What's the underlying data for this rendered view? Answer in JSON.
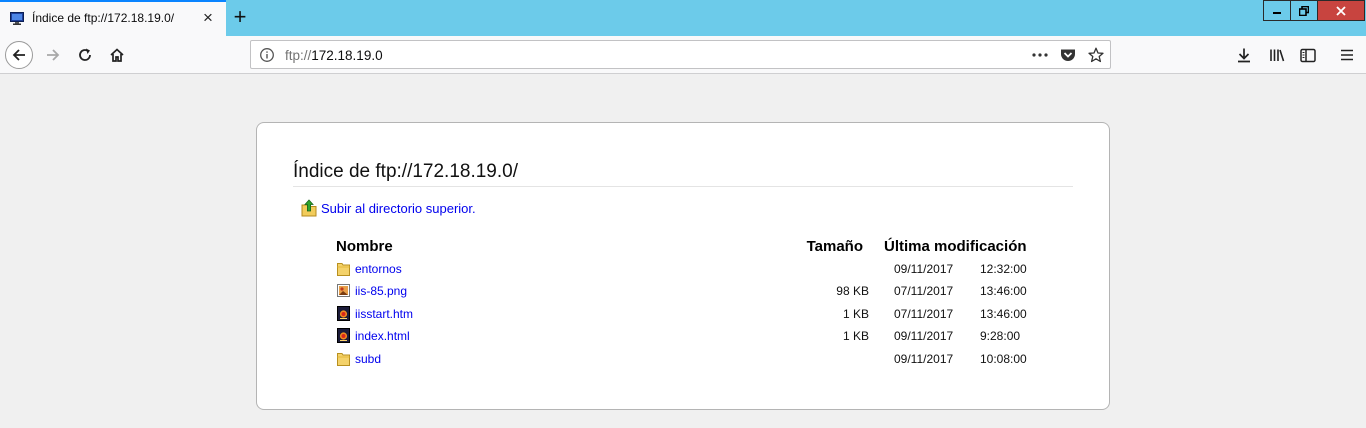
{
  "tab": {
    "title": "Índice de ftp://172.18.19.0/",
    "close_label": "×",
    "new_tab_label": "+"
  },
  "urlbar": {
    "scheme": "ftp://",
    "host": "172.18.19.0"
  },
  "page": {
    "title": "Índice de ftp://172.18.19.0/",
    "up_link": "Subir al directorio superior.",
    "columns": {
      "name": "Nombre",
      "size": "Tamaño",
      "modified": "Última modificación"
    },
    "rows": [
      {
        "name": "entornos",
        "type": "folder",
        "size": "",
        "date": "09/11/2017",
        "time": "12:32:00"
      },
      {
        "name": "iis-85.png",
        "type": "image",
        "size": "98 KB",
        "date": "07/11/2017",
        "time": "13:46:00"
      },
      {
        "name": "iisstart.htm",
        "type": "html",
        "size": "1 KB",
        "date": "07/11/2017",
        "time": "13:46:00"
      },
      {
        "name": "index.html",
        "type": "html",
        "size": "1 KB",
        "date": "09/11/2017",
        "time": "9:28:00"
      },
      {
        "name": "subd",
        "type": "folder",
        "size": "",
        "date": "09/11/2017",
        "time": "10:08:00"
      }
    ]
  },
  "icons": {
    "tab_favicon": "ftp-favicon-icon",
    "back": "arrow-left-icon",
    "forward": "arrow-right-icon",
    "reload": "reload-icon",
    "home": "home-icon",
    "site_info": "info-icon",
    "page_actions": "ellipsis-icon",
    "pocket": "pocket-icon",
    "bookmark": "star-icon",
    "downloads": "download-icon",
    "library": "library-icon",
    "sidebar": "sidebar-icon",
    "menu": "hamburger-menu-icon"
  },
  "colors": {
    "titlebar": "#6ccbea",
    "link": "#0000ee",
    "close_button": "#c8443f"
  }
}
